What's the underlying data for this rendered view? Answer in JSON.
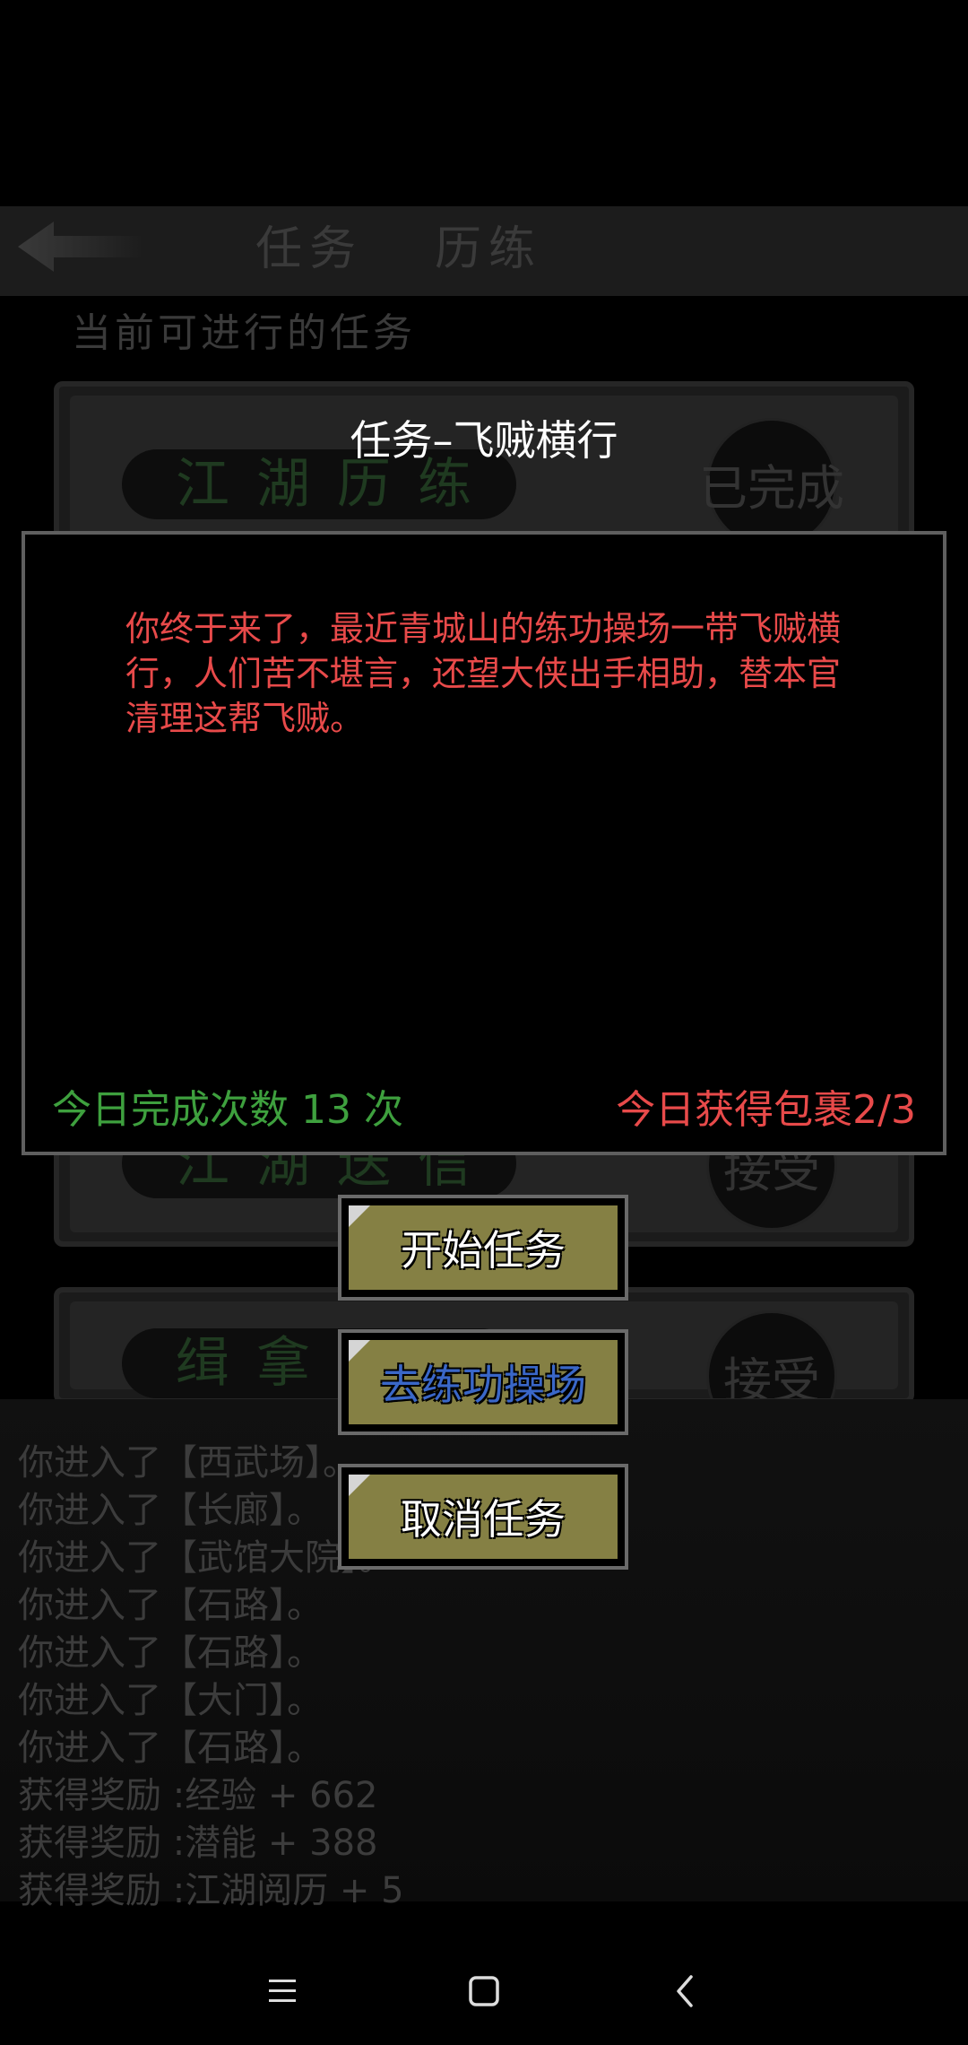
{
  "background": {
    "tabs": [
      "任务",
      "历练"
    ],
    "section_title": "当前可进行的任务",
    "tasks": [
      {
        "name": "江湖历练",
        "status": "已完成"
      },
      {
        "name": "",
        "status": ""
      },
      {
        "name": "",
        "status": ""
      },
      {
        "name": "江湖送信",
        "status": "接受"
      },
      {
        "name": "缉拿",
        "status": "接受"
      }
    ],
    "log": [
      "你进入了【西武场】。",
      "你进入了【长廊】。",
      "你进入了【武馆大院】。",
      "你进入了【石路】。",
      "你进入了【石路】。",
      "你进入了【大门】。",
      "你进入了【石路】。",
      "获得奖励 :经验 + 662",
      "获得奖励 :潜能 + 388",
      "获得奖励 :江湖阅历 + 5"
    ]
  },
  "dialog": {
    "title": "任务–飞贼横行",
    "message": "你终于来了，最近青城山的练功操场一带飞贼横行，人们苦不堪言，还望大侠出手相助，替本官清理这帮飞贼。",
    "count_text": "今日完成次数 13 次",
    "package_text": "今日获得包裹2/3"
  },
  "buttons": {
    "start": "开始任务",
    "goto": "去练功操场",
    "cancel": "取消任务"
  },
  "colors": {
    "message_red": "#e84a4a",
    "count_green": "#3ea03e",
    "button_olive": "#858044",
    "goto_blue": "#3a67c8"
  },
  "icons": {
    "back": "back-arrow-icon",
    "menu": "menu-icon",
    "home": "home-icon",
    "back_nav": "back-nav-icon"
  }
}
